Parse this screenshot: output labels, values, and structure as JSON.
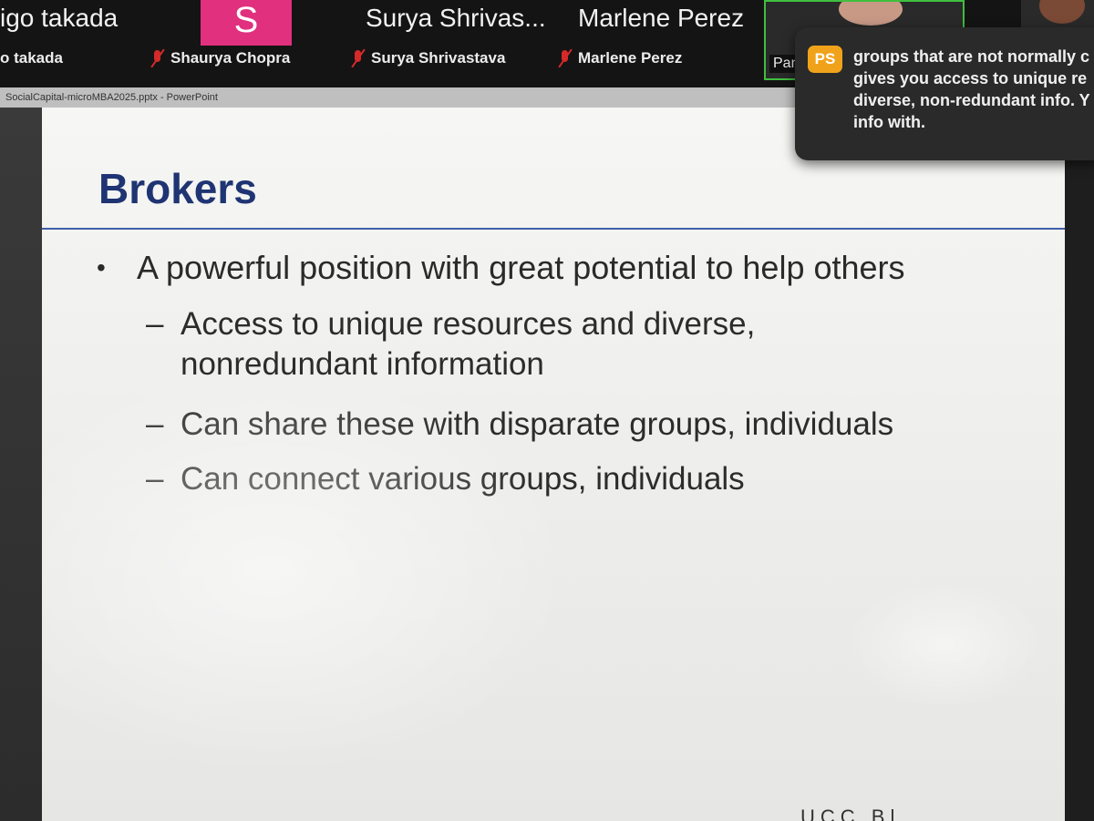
{
  "gallery": {
    "tile_1": {
      "name_big": "igo takada",
      "name_small": "o takada"
    },
    "tile_2": {
      "avatar_letter": "S",
      "name_small": "Shaurya Chopra"
    },
    "tile_3": {
      "name_big": "Surya Shrivas...",
      "name_small": "Surya Shrivastava"
    },
    "tile_4": {
      "name_big": "Marlene Perez",
      "name_small": "Marlene Perez"
    },
    "tile_5": {
      "name_small": "Pan"
    }
  },
  "chat": {
    "avatar_initials": "PS",
    "message": "groups that are not normally c\ngives you access to unique re\ndiverse, non-redundant info. Y\ninfo with."
  },
  "window": {
    "title": "SocialCapital-microMBA2025.pptx - PowerPoint"
  },
  "slide": {
    "title": "Brokers",
    "bullet": "A powerful position with great potential to help others",
    "sub_items": [
      "Access to unique resources and diverse,\nnonredundant information",
      "Can share these with disparate groups, individuals",
      "Can connect various groups, individuals"
    ],
    "footer_logo_text": "UCC  Bl"
  },
  "colors": {
    "title": "#1f3473",
    "rule": "#3f5fa8",
    "avatar_s": "#e0307e",
    "chat_avatar": "#f0a31a",
    "active_speaker_border": "#3fbf3f",
    "muted": "#d42a2a"
  }
}
